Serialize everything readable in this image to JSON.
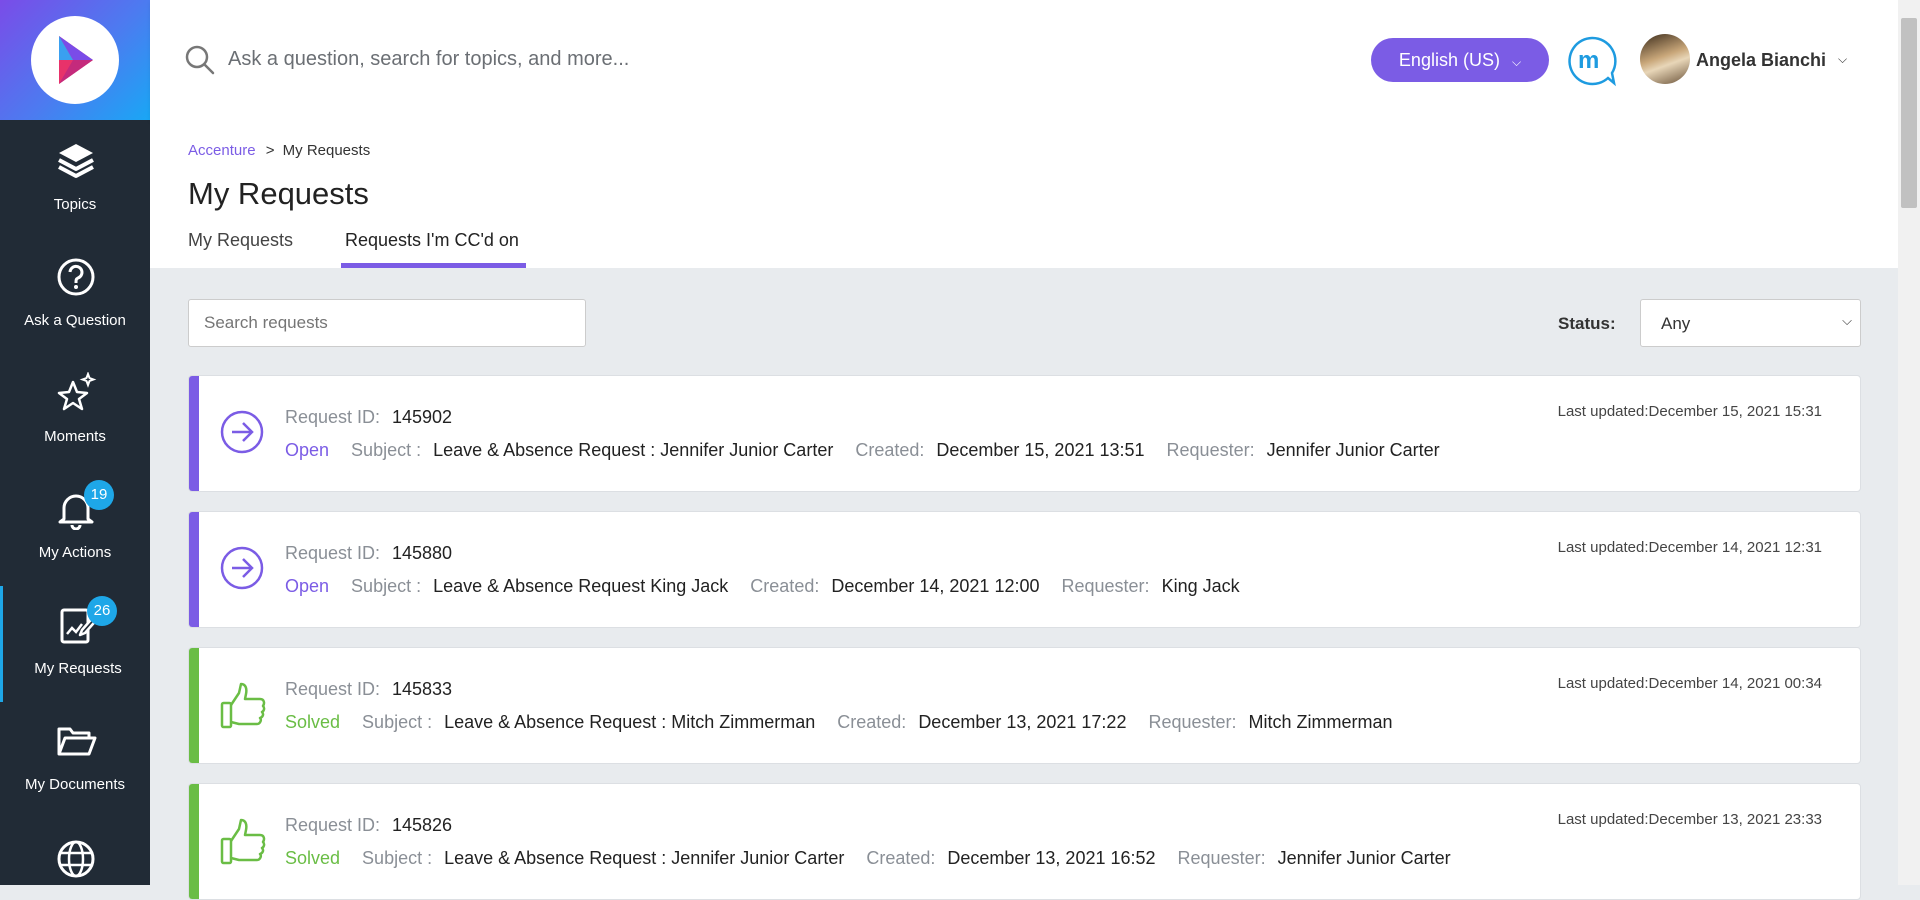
{
  "search": {
    "placeholder": "Ask a question, search for topics, and more..."
  },
  "header": {
    "language": "English (US)",
    "user_name": "Angela Bianchi"
  },
  "sidebar": {
    "items": [
      {
        "label": "Topics",
        "icon": "layers-icon"
      },
      {
        "label": "Ask a Question",
        "icon": "question-icon"
      },
      {
        "label": "Moments",
        "icon": "sparkle-star-icon"
      },
      {
        "label": "My Actions",
        "icon": "bell-icon",
        "badge": "19"
      },
      {
        "label": "My Requests",
        "icon": "request-form-icon",
        "badge": "26",
        "active": true
      },
      {
        "label": "My Documents",
        "icon": "folder-icon"
      },
      {
        "label": "",
        "icon": "globe-icon"
      }
    ]
  },
  "breadcrumb": {
    "root": "Accenture",
    "separator": ">",
    "current": "My Requests"
  },
  "page": {
    "title": "My Requests"
  },
  "tabs": [
    {
      "label": "My Requests",
      "active": false
    },
    {
      "label": "Requests I'm CC'd on",
      "active": true
    }
  ],
  "filters": {
    "search_placeholder": "Search requests",
    "status_label": "Status:",
    "status_value": "Any"
  },
  "labels": {
    "request_id": "Request ID:",
    "subject": "Subject :",
    "created": "Created:",
    "requester": "Requester:",
    "last_updated": "Last updated:"
  },
  "requests": [
    {
      "id": "145902",
      "status": "Open",
      "subject": "Leave & Absence Request : Jennifer Junior Carter",
      "created": "December 15, 2021 13:51",
      "requester": "Jennifer Junior Carter",
      "updated": "December 15, 2021 15:31"
    },
    {
      "id": "145880",
      "status": "Open",
      "subject": "Leave & Absence Request King Jack",
      "created": "December 14, 2021 12:00",
      "requester": "King Jack",
      "updated": "December 14, 2021 12:31"
    },
    {
      "id": "145833",
      "status": "Solved",
      "subject": "Leave & Absence Request : Mitch Zimmerman",
      "created": "December 13, 2021 17:22",
      "requester": "Mitch Zimmerman",
      "updated": "December 14, 2021 00:34"
    },
    {
      "id": "145826",
      "status": "Solved",
      "subject": "Leave & Absence Request : Jennifer Junior Carter",
      "created": "December 13, 2021 16:52",
      "requester": "Jennifer Junior Carter",
      "updated": "December 13, 2021 23:33"
    }
  ],
  "colors": {
    "accent": "#7b5ce5",
    "open": "#7b5ce5",
    "solved": "#6abd45",
    "badge": "#1ea7e8",
    "sidebar": "#212b36"
  }
}
